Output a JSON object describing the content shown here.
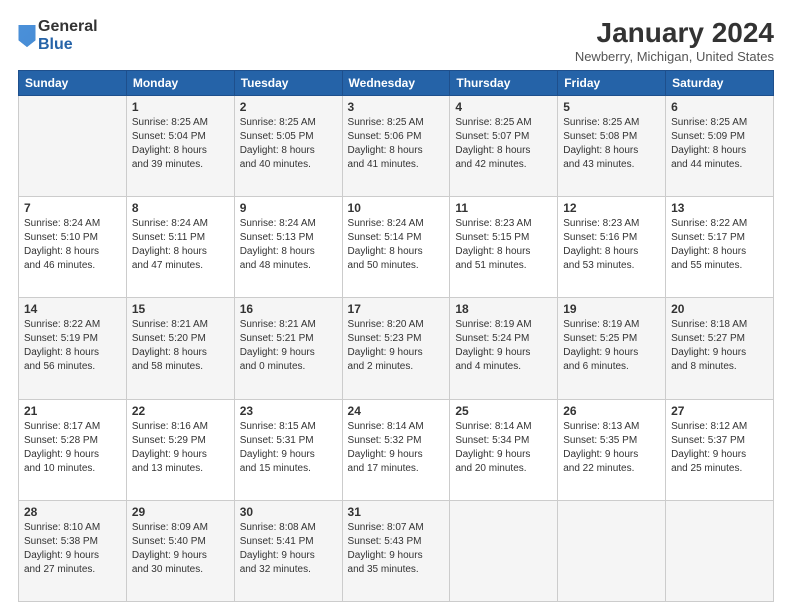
{
  "logo": {
    "general": "General",
    "blue": "Blue"
  },
  "title": "January 2024",
  "subtitle": "Newberry, Michigan, United States",
  "days": [
    "Sunday",
    "Monday",
    "Tuesday",
    "Wednesday",
    "Thursday",
    "Friday",
    "Saturday"
  ],
  "weeks": [
    [
      {
        "day": "",
        "info": ""
      },
      {
        "day": "1",
        "info": "Sunrise: 8:25 AM\nSunset: 5:04 PM\nDaylight: 8 hours\nand 39 minutes."
      },
      {
        "day": "2",
        "info": "Sunrise: 8:25 AM\nSunset: 5:05 PM\nDaylight: 8 hours\nand 40 minutes."
      },
      {
        "day": "3",
        "info": "Sunrise: 8:25 AM\nSunset: 5:06 PM\nDaylight: 8 hours\nand 41 minutes."
      },
      {
        "day": "4",
        "info": "Sunrise: 8:25 AM\nSunset: 5:07 PM\nDaylight: 8 hours\nand 42 minutes."
      },
      {
        "day": "5",
        "info": "Sunrise: 8:25 AM\nSunset: 5:08 PM\nDaylight: 8 hours\nand 43 minutes."
      },
      {
        "day": "6",
        "info": "Sunrise: 8:25 AM\nSunset: 5:09 PM\nDaylight: 8 hours\nand 44 minutes."
      }
    ],
    [
      {
        "day": "7",
        "info": "Sunrise: 8:24 AM\nSunset: 5:10 PM\nDaylight: 8 hours\nand 46 minutes."
      },
      {
        "day": "8",
        "info": "Sunrise: 8:24 AM\nSunset: 5:11 PM\nDaylight: 8 hours\nand 47 minutes."
      },
      {
        "day": "9",
        "info": "Sunrise: 8:24 AM\nSunset: 5:13 PM\nDaylight: 8 hours\nand 48 minutes."
      },
      {
        "day": "10",
        "info": "Sunrise: 8:24 AM\nSunset: 5:14 PM\nDaylight: 8 hours\nand 50 minutes."
      },
      {
        "day": "11",
        "info": "Sunrise: 8:23 AM\nSunset: 5:15 PM\nDaylight: 8 hours\nand 51 minutes."
      },
      {
        "day": "12",
        "info": "Sunrise: 8:23 AM\nSunset: 5:16 PM\nDaylight: 8 hours\nand 53 minutes."
      },
      {
        "day": "13",
        "info": "Sunrise: 8:22 AM\nSunset: 5:17 PM\nDaylight: 8 hours\nand 55 minutes."
      }
    ],
    [
      {
        "day": "14",
        "info": "Sunrise: 8:22 AM\nSunset: 5:19 PM\nDaylight: 8 hours\nand 56 minutes."
      },
      {
        "day": "15",
        "info": "Sunrise: 8:21 AM\nSunset: 5:20 PM\nDaylight: 8 hours\nand 58 minutes."
      },
      {
        "day": "16",
        "info": "Sunrise: 8:21 AM\nSunset: 5:21 PM\nDaylight: 9 hours\nand 0 minutes."
      },
      {
        "day": "17",
        "info": "Sunrise: 8:20 AM\nSunset: 5:23 PM\nDaylight: 9 hours\nand 2 minutes."
      },
      {
        "day": "18",
        "info": "Sunrise: 8:19 AM\nSunset: 5:24 PM\nDaylight: 9 hours\nand 4 minutes."
      },
      {
        "day": "19",
        "info": "Sunrise: 8:19 AM\nSunset: 5:25 PM\nDaylight: 9 hours\nand 6 minutes."
      },
      {
        "day": "20",
        "info": "Sunrise: 8:18 AM\nSunset: 5:27 PM\nDaylight: 9 hours\nand 8 minutes."
      }
    ],
    [
      {
        "day": "21",
        "info": "Sunrise: 8:17 AM\nSunset: 5:28 PM\nDaylight: 9 hours\nand 10 minutes."
      },
      {
        "day": "22",
        "info": "Sunrise: 8:16 AM\nSunset: 5:29 PM\nDaylight: 9 hours\nand 13 minutes."
      },
      {
        "day": "23",
        "info": "Sunrise: 8:15 AM\nSunset: 5:31 PM\nDaylight: 9 hours\nand 15 minutes."
      },
      {
        "day": "24",
        "info": "Sunrise: 8:14 AM\nSunset: 5:32 PM\nDaylight: 9 hours\nand 17 minutes."
      },
      {
        "day": "25",
        "info": "Sunrise: 8:14 AM\nSunset: 5:34 PM\nDaylight: 9 hours\nand 20 minutes."
      },
      {
        "day": "26",
        "info": "Sunrise: 8:13 AM\nSunset: 5:35 PM\nDaylight: 9 hours\nand 22 minutes."
      },
      {
        "day": "27",
        "info": "Sunrise: 8:12 AM\nSunset: 5:37 PM\nDaylight: 9 hours\nand 25 minutes."
      }
    ],
    [
      {
        "day": "28",
        "info": "Sunrise: 8:10 AM\nSunset: 5:38 PM\nDaylight: 9 hours\nand 27 minutes."
      },
      {
        "day": "29",
        "info": "Sunrise: 8:09 AM\nSunset: 5:40 PM\nDaylight: 9 hours\nand 30 minutes."
      },
      {
        "day": "30",
        "info": "Sunrise: 8:08 AM\nSunset: 5:41 PM\nDaylight: 9 hours\nand 32 minutes."
      },
      {
        "day": "31",
        "info": "Sunrise: 8:07 AM\nSunset: 5:43 PM\nDaylight: 9 hours\nand 35 minutes."
      },
      {
        "day": "",
        "info": ""
      },
      {
        "day": "",
        "info": ""
      },
      {
        "day": "",
        "info": ""
      }
    ]
  ]
}
